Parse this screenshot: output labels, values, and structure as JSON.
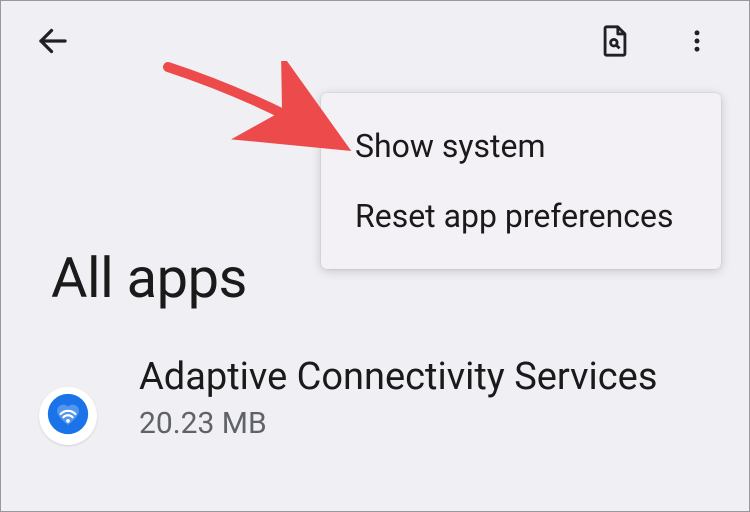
{
  "header": {
    "title": "All apps"
  },
  "menu": {
    "items": [
      {
        "label": "Show system"
      },
      {
        "label": "Reset app preferences"
      }
    ]
  },
  "apps": [
    {
      "name": "Adaptive Connectivity Services",
      "size": "20.23 MB",
      "icon": "heart-wifi-icon",
      "iconBg": "#1a73e8"
    }
  ],
  "annotation": {
    "arrowColor": "#ed4b4b"
  }
}
